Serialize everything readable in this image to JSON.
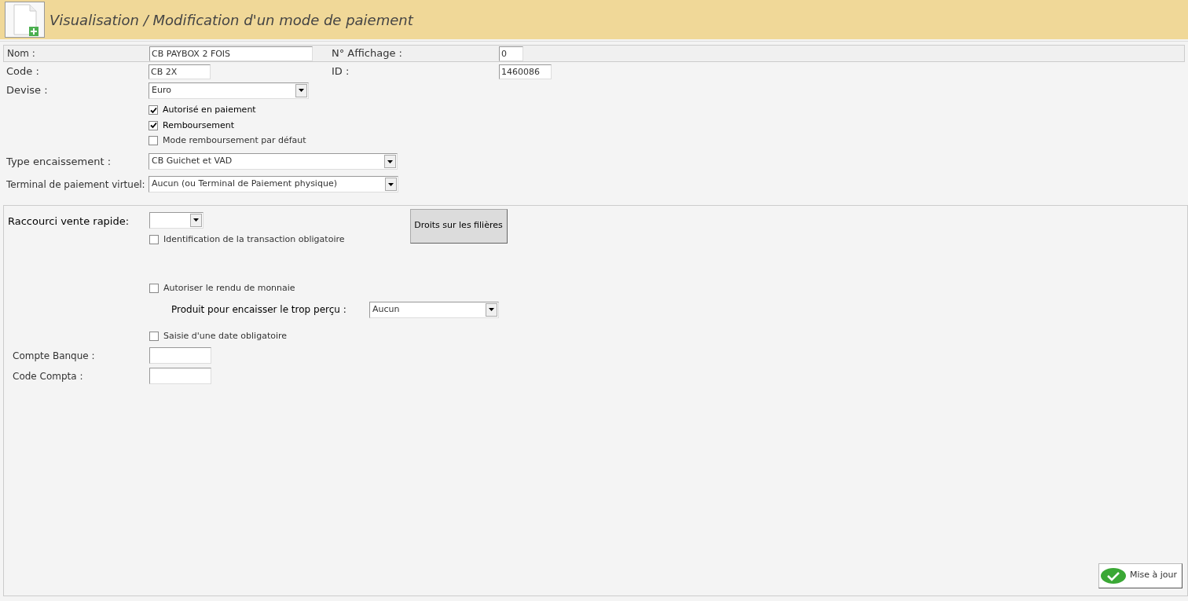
{
  "header": {
    "title": "Visualisation / Modification d'un mode de paiement"
  },
  "general": {
    "nom": {
      "label": "Nom :",
      "value": "CB PAYBOX 2 FOIS"
    },
    "affichage": {
      "label": "N° Affichage :",
      "value": "0"
    },
    "code": {
      "label": "Code :",
      "value": "CB 2X"
    },
    "id": {
      "label": "ID :",
      "value": "1460086"
    },
    "devise": {
      "label": "Devise :",
      "value": "Euro"
    },
    "checkboxes": [
      {
        "label": "Autorisé en paiement",
        "checked": true
      },
      {
        "label": "Remboursement",
        "checked": true
      },
      {
        "label": "Mode remboursement par défaut",
        "checked": false
      }
    ],
    "type_encaissement": {
      "label": "Type encaissement :",
      "value": "CB Guichet et VAD"
    },
    "terminal": {
      "label": "Terminal de paiement virtuel:",
      "value": "Aucun (ou Terminal de Paiement physique)"
    }
  },
  "options": {
    "raccourci": {
      "label": "Raccourci vente rapide:"
    },
    "droits_button": "Droits sur les filières",
    "identification": {
      "label": "Identification de la transaction obligatoire",
      "checked": false
    },
    "rendu_monnaie": {
      "label": "Autoriser le rendu de monnaie",
      "checked": false
    },
    "produit": {
      "label": "Produit pour encaisser le trop perçu :",
      "value": "Aucun"
    },
    "saisie_date": {
      "label": "Saisie d'une date obligatoire",
      "checked": false
    },
    "compte_banque": {
      "label": "Compte Banque :"
    },
    "code_compta": {
      "label": "Code Compta :"
    }
  },
  "update_button": "Mise à jour"
}
